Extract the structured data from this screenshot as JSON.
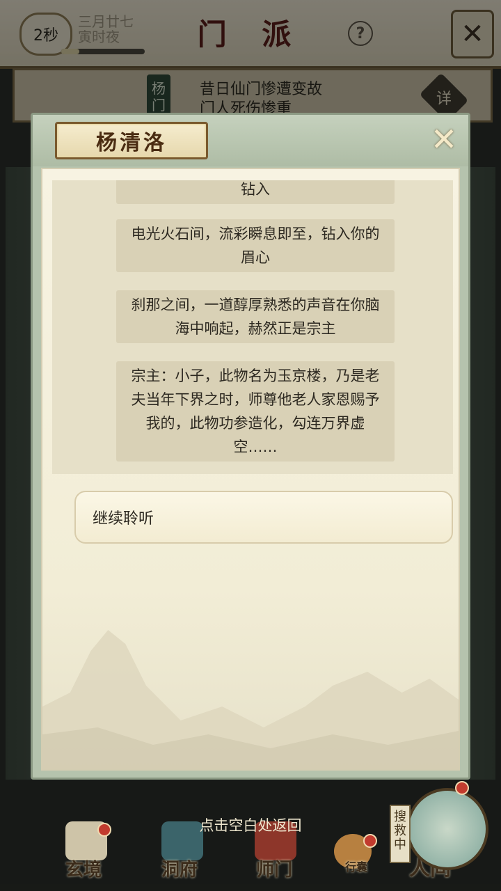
{
  "header": {
    "timer": "2秒",
    "date_line1": "三月廿七",
    "date_line2": "寅时夜",
    "title": "门 派",
    "help_icon": "?",
    "close_icon": "✕"
  },
  "sect_panel": {
    "vertical_name": "杨门",
    "description": "昔日仙门惨遭变故\n门人死伤惨重",
    "detail_button": "详"
  },
  "dialog": {
    "npc_name": "杨清洛",
    "close_icon": "✕",
    "messages": [
      "钻入",
      "电光火石间，流彩瞬息即至，钻入你的眉心",
      "刹那之间，一道醇厚熟悉的声音在你脑海中响起，赫然正是宗主",
      "宗主：小子，此物名为玉京楼，乃是老夫当年下界之时，师尊他老人家恩赐予我的，此物功参造化，勾连万界虚空……"
    ],
    "continue_label": "继续聆听",
    "return_hint": "点击空白处返回"
  },
  "bottom_nav": {
    "items": [
      "玄境",
      "洞府",
      "师门",
      "行囊",
      "人间"
    ],
    "search_tag": "搜救中"
  },
  "colors": {
    "plaque_text": "#4a2c12",
    "accent_red": "#c23b2e",
    "panel_green": "#b5c3ad"
  }
}
